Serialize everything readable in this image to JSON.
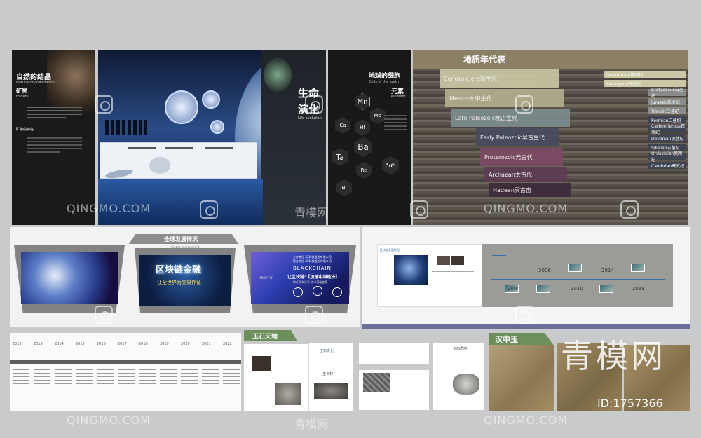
{
  "watermark": {
    "brand_latin": "QINGMO.COM",
    "brand_cn": "青模网",
    "big_cn": "青模网",
    "id_text": "ID:1757366"
  },
  "panel1": {
    "title_cn": "自然的结晶",
    "subtitle_en": "Natural crystallization",
    "mineral_cn": "矿物",
    "mineral_en": "mineral",
    "section": "矿物的特征"
  },
  "panel2": {
    "title_cn_1": "生命",
    "title_cn_2": "演化",
    "subtitle_en": "Life evolution"
  },
  "panel3": {
    "title_cn": "地球的细胞",
    "subtitle_en": "Cells of the earth",
    "element_cn": "元素",
    "element_en": "element",
    "hexes": [
      "Mn",
      "Md",
      "Ca",
      "Hf",
      "Ba",
      "Ta",
      "Re",
      "Se",
      "Ni"
    ]
  },
  "geo": {
    "title": "地质年代表",
    "rows": [
      "Cenozoic era新生代",
      "Mesozoic中生代",
      "Late Paleozoic晚古生代",
      "Early Paleozoic早古生代",
      "Proterozoic元古代",
      "Archaean太古代",
      "Hadean冥古宙"
    ],
    "periods": [
      "Quaternary第四纪",
      "Paleogene古近纪",
      "Cretaceous白垩纪",
      "Jurassic侏罗纪",
      "Triassic三叠纪",
      "Permian二叠纪",
      "Carboniferous石炭纪",
      "Devonian泥盆纪",
      "Silurian志留纪",
      "Ordovician奥陶纪",
      "Cambrian寒武纪"
    ],
    "colors": [
      "#c9c7a4",
      "#b3ae8e",
      "#7d8c8e",
      "#474c60",
      "#7c4a63",
      "#5d3c52",
      "#3c2a39"
    ]
  },
  "global": {
    "tab": "全球发展情况",
    "tab_en": "Global development",
    "center_big": "区块链金融",
    "center_sub": "让全世界为交易作证",
    "right_l1": "主办单位 XX科技股份有限公司",
    "right_l2": "协办单位 XX科技股份有限公司",
    "right_brand": "BLACKCHAIN",
    "right_title": "让区块链:【加速中国经济】",
    "right_sub": "特任周海经济 技术基础变革",
    "right_about": "ABOUT IT"
  },
  "timeline": {
    "heading": "区块链发展进程",
    "years_top": [
      "2006",
      "2014"
    ],
    "years_bottom": [
      "2004",
      "2010",
      "2018"
    ]
  },
  "years_strip": [
    "2012",
    "2013",
    "2014",
    "2015",
    "2016",
    "2017",
    "2018",
    "2019",
    "2020",
    "2021",
    "2022"
  ],
  "jade": {
    "tag1": "玉石天地",
    "tag2": "汉中玉",
    "book_title1": "玉石文化",
    "book_title2": "玉石材",
    "book_title3": "玉石质感"
  }
}
